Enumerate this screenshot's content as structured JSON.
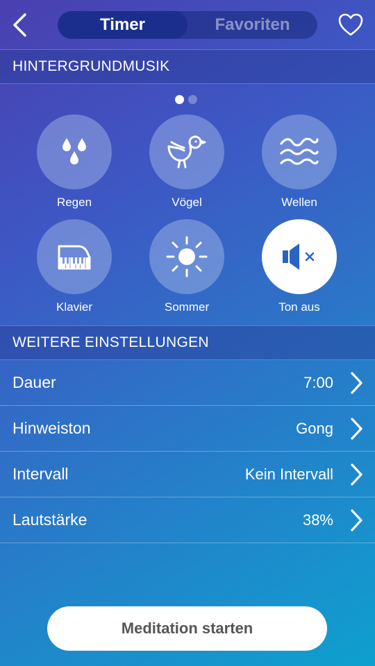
{
  "header": {
    "tabs": [
      {
        "label": "Timer",
        "active": true
      },
      {
        "label": "Favoriten",
        "active": false
      }
    ]
  },
  "background_music": {
    "title": "HINTERGRUNDMUSIK",
    "page_indicator": {
      "current": 1,
      "total": 2
    },
    "sounds": [
      {
        "label": "Regen",
        "icon": "rain-drops-icon"
      },
      {
        "label": "Vögel",
        "icon": "bird-icon"
      },
      {
        "label": "Wellen",
        "icon": "waves-icon"
      },
      {
        "label": "Klavier",
        "icon": "piano-icon"
      },
      {
        "label": "Sommer",
        "icon": "sun-icon"
      },
      {
        "label": "Ton aus",
        "icon": "speaker-mute-icon",
        "selected": true
      }
    ]
  },
  "settings": {
    "title": "WEITERE EINSTELLUNGEN",
    "rows": [
      {
        "label": "Dauer",
        "value": "7:00"
      },
      {
        "label": "Hinweiston",
        "value": "Gong"
      },
      {
        "label": "Intervall",
        "value": "Kein Intervall"
      },
      {
        "label": "Lautstärke",
        "value": "38%"
      }
    ]
  },
  "start_button": {
    "label": "Meditation starten"
  },
  "colors": {
    "accent_icon": "#2a64c0",
    "button_text": "#555555"
  }
}
